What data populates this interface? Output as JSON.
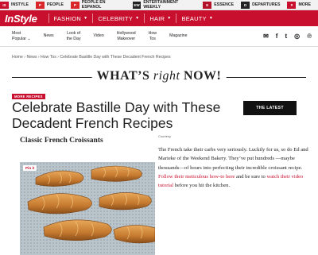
{
  "network": [
    {
      "badge": "IS",
      "label": "INSTYLE",
      "color": "#c8102e"
    },
    {
      "badge": "P",
      "label": "PEOPLE",
      "color": "#d9262b"
    },
    {
      "badge": "P",
      "label": "PEOPLE EN ESPANOL",
      "color": "#d9262b"
    },
    {
      "badge": "EW",
      "label": "ENTERTAINMENT WEEKLY",
      "color": "#222222"
    },
    {
      "badge": "E",
      "label": "ESSENCE",
      "color": "#b4122b"
    },
    {
      "badge": "D",
      "label": "DEPARTURES",
      "color": "#222222"
    },
    {
      "badge": "",
      "label": "MORE",
      "color": "#f2f2f2"
    }
  ],
  "header": {
    "logo": "InStyle",
    "nav": [
      {
        "label": "FASHION",
        "caret": "▼"
      },
      {
        "label": "CELEBRITY",
        "caret": "▼"
      },
      {
        "label": "HAIR",
        "caret": "▼"
      },
      {
        "label": "BEAUTY",
        "caret": "▼"
      }
    ],
    "accent": "#c8102e"
  },
  "subnav": [
    {
      "line1": "Most",
      "line2": "Popular ⌄"
    },
    {
      "line1": "News",
      "line2": ""
    },
    {
      "line1": "Look of",
      "line2": "the Day"
    },
    {
      "line1": "Video",
      "line2": ""
    },
    {
      "line1": "Hollywood",
      "line2": "Makeover"
    },
    {
      "line1": "How",
      "line2": "Tos"
    },
    {
      "line1": "Magazine",
      "line2": ""
    }
  ],
  "social": [
    "envelope-icon",
    "facebook-icon",
    "twitter-icon",
    "instagram-icon",
    "pinterest-icon"
  ],
  "breadcrumb": "Home › News › How Tos › Celebrate Bastille Day with These Decadent French Recipes",
  "banner": {
    "pre": "WHAT’S ",
    "em": "right",
    "post": " NOW!"
  },
  "tag": "MORE RECIPES",
  "headline": "Celebrate Bastille Day with These Decadent French Recipes",
  "latest_button": "THE LATEST",
  "subhead": "Classic French Croissants",
  "credit": "Courtesy",
  "body": {
    "text1": "The French take their carbs very seriously. Luckily for us, so do Ed and Marieke of the Weekend Bakery. They’ve put hundreds —maybe thousands—of hours into perfecting their incredible croissant recipe. ",
    "link1": "Follow their meticulous how-to here",
    "text2": " and be sure to ",
    "link2": "watch their video tutorial",
    "text3": " before you hit the kitchen."
  },
  "pin_label": "Pin it"
}
